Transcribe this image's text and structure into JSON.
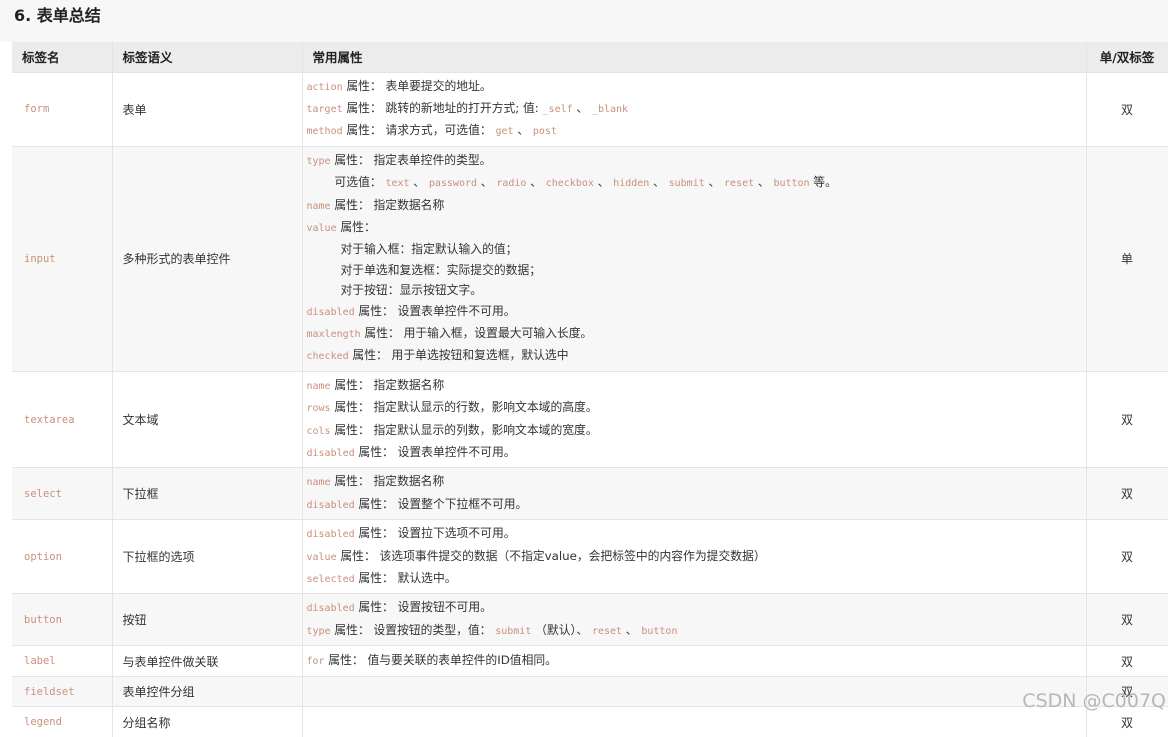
{
  "section_title": "6. 表单总结",
  "headers": [
    "标签名",
    "标签语义",
    "常用属性",
    "单/双标签"
  ],
  "rows": [
    {
      "tag": "form",
      "semantic": "表单",
      "type": "双",
      "height": 71,
      "attrs": [
        [
          {
            "c": "action"
          },
          {
            "t": " 属性： 表单要提交的地址。"
          }
        ],
        [
          {
            "c": "target"
          },
          {
            "t": " 属性： 跳转的新地址的打开方式; 值: "
          },
          {
            "c": "_self"
          },
          {
            "t": " 、 "
          },
          {
            "c": "_blank"
          }
        ],
        [
          {
            "c": "method"
          },
          {
            "t": " 属性： 请求方式，可选值： "
          },
          {
            "c": "get"
          },
          {
            "t": " 、 "
          },
          {
            "c": "post"
          }
        ]
      ]
    },
    {
      "tag": "input",
      "semantic": "多种形式的表单控件",
      "type": "单",
      "attrs": [
        [
          {
            "c": "type"
          },
          {
            "t": " 属性： 指定表单控件的类型。"
          }
        ],
        [
          {
            "i": 1
          },
          {
            "t": "可选值： "
          },
          {
            "c": "text"
          },
          {
            "t": " 、 "
          },
          {
            "c": "password"
          },
          {
            "t": " 、 "
          },
          {
            "c": "radio"
          },
          {
            "t": " 、 "
          },
          {
            "c": "checkbox"
          },
          {
            "t": " 、 "
          },
          {
            "c": "hidden"
          },
          {
            "t": " 、 "
          },
          {
            "c": "submit"
          },
          {
            "t": " 、 "
          },
          {
            "c": "reset"
          },
          {
            "t": " 、 "
          },
          {
            "c": "button"
          },
          {
            "t": " 等。"
          }
        ],
        [
          {
            "c": "name"
          },
          {
            "t": " 属性： 指定数据名称"
          }
        ],
        [
          {
            "c": "value"
          },
          {
            "t": " 属性："
          }
        ],
        [
          {
            "i": 2
          },
          {
            "t": "对于输入框：指定默认输入的值；"
          }
        ],
        [
          {
            "i": 2
          },
          {
            "t": "对于单选和复选框：实际提交的数据；"
          }
        ],
        [
          {
            "i": 2
          },
          {
            "t": "对于按钮：显示按钮文字。"
          }
        ],
        [
          {
            "c": "disabled"
          },
          {
            "t": " 属性： 设置表单控件不可用。"
          }
        ],
        [
          {
            "c": "maxlength"
          },
          {
            "t": " 属性： 用于输入框，设置最大可输入长度。"
          }
        ],
        [
          {
            "c": "checked"
          },
          {
            "t": " 属性： 用于单选按钮和复选框，默认选中"
          }
        ]
      ]
    },
    {
      "tag": "textarea",
      "semantic": "文本域",
      "type": "双",
      "attrs": [
        [
          {
            "c": "name"
          },
          {
            "t": " 属性： 指定数据名称"
          }
        ],
        [
          {
            "c": "rows"
          },
          {
            "t": " 属性： 指定默认显示的行数，影响文本域的高度。"
          }
        ],
        [
          {
            "c": "cols"
          },
          {
            "t": " 属性： 指定默认显示的列数，影响文本域的宽度。"
          }
        ],
        [
          {
            "c": "disabled"
          },
          {
            "t": " 属性： 设置表单控件不可用。"
          }
        ]
      ]
    },
    {
      "tag": "select",
      "semantic": "下拉框",
      "type": "双",
      "attrs": [
        [
          {
            "c": "name"
          },
          {
            "t": " 属性： 指定数据名称"
          }
        ],
        [
          {
            "c": "disabled"
          },
          {
            "t": " 属性： 设置整个下拉框不可用。"
          }
        ]
      ]
    },
    {
      "tag": "option",
      "semantic": "下拉框的选项",
      "type": "双",
      "attrs": [
        [
          {
            "c": "disabled"
          },
          {
            "t": " 属性： 设置拉下选项不可用。"
          }
        ],
        [
          {
            "c": "value"
          },
          {
            "t": " 属性： 该选项事件提交的数据（不指定value，会把标签中的内容作为提交数据）"
          }
        ],
        [
          {
            "c": "selected"
          },
          {
            "t": " 属性： 默认选中。"
          }
        ]
      ]
    },
    {
      "tag": "button",
      "semantic": "按钮",
      "type": "双",
      "attrs": [
        [
          {
            "c": "disabled"
          },
          {
            "t": " 属性： 设置按钮不可用。"
          }
        ],
        [
          {
            "c": "type"
          },
          {
            "t": " 属性： 设置按钮的类型，值： "
          },
          {
            "c": "submit"
          },
          {
            "t": " （默认）、 "
          },
          {
            "c": "reset"
          },
          {
            "t": " 、 "
          },
          {
            "c": "button"
          }
        ]
      ]
    },
    {
      "tag": "label",
      "semantic": "与表单控件做关联",
      "type": "双",
      "attrs": [
        [
          {
            "c": "for"
          },
          {
            "t": " 属性： 值与要关联的表单控件的ID值相同。"
          }
        ]
      ]
    },
    {
      "tag": "fieldset",
      "semantic": "表单控件分组",
      "type": "双",
      "attrs": []
    },
    {
      "tag": "legend",
      "semantic": "分组名称",
      "type": "双",
      "attrs": []
    }
  ],
  "watermark": "CSDN @C007Q"
}
